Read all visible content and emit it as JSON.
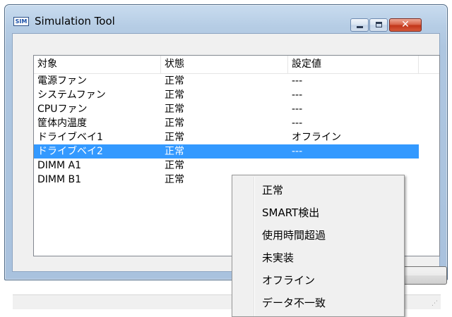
{
  "window": {
    "title": "Simulation Tool",
    "icon_label": "SIM",
    "icon": "sim-app-icon",
    "controls": {
      "minimize_icon": "minimize-icon",
      "maximize_icon": "maximize-icon",
      "close_icon": "close-icon",
      "close_glyph": "✕"
    }
  },
  "table": {
    "columns": [
      "対象",
      "状態",
      "設定値"
    ],
    "rows": [
      {
        "target": "電源ファン",
        "status": "正常",
        "value": "---"
      },
      {
        "target": "システムファン",
        "status": "正常",
        "value": "---"
      },
      {
        "target": "CPUファン",
        "status": "正常",
        "value": "---"
      },
      {
        "target": "筐体内温度",
        "status": "正常",
        "value": "---"
      },
      {
        "target": "ドライブベイ1",
        "status": "正常",
        "value": "オフライン"
      },
      {
        "target": "ドライブベイ2",
        "status": "正常",
        "value": "---"
      },
      {
        "target": "DIMM A1",
        "status": "正常",
        "value": ""
      },
      {
        "target": "DIMM B1",
        "status": "正常",
        "value": ""
      }
    ],
    "selected_row_index": 5
  },
  "context_menu": {
    "items": [
      "正常",
      "SMART検出",
      "使用時間超過",
      "未実装",
      "オフライン",
      "データ不一致"
    ]
  },
  "colors": {
    "selection": "#3399ff",
    "close_button": "#c2361a",
    "titlebar": "#b6cde5"
  }
}
